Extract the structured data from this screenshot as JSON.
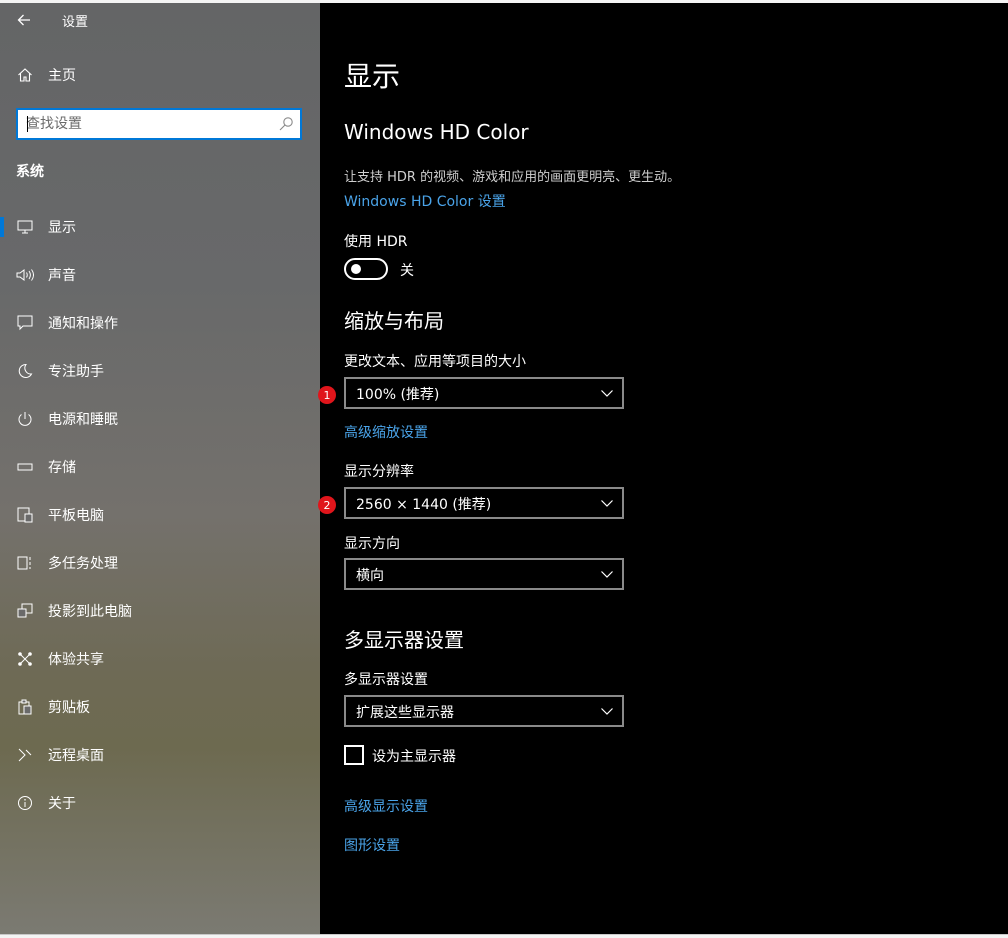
{
  "app": {
    "title": "设置"
  },
  "sidebar": {
    "home_label": "主页",
    "search_placeholder": "查找设置",
    "section": "系统",
    "items": [
      {
        "label": "显示",
        "icon": "monitor-icon",
        "active": true
      },
      {
        "label": "声音",
        "icon": "speaker-icon"
      },
      {
        "label": "通知和操作",
        "icon": "notification-icon"
      },
      {
        "label": "专注助手",
        "icon": "moon-icon"
      },
      {
        "label": "电源和睡眠",
        "icon": "power-icon"
      },
      {
        "label": "存储",
        "icon": "storage-icon"
      },
      {
        "label": "平板电脑",
        "icon": "tablet-icon"
      },
      {
        "label": "多任务处理",
        "icon": "multitask-icon"
      },
      {
        "label": "投影到此电脑",
        "icon": "project-icon"
      },
      {
        "label": "体验共享",
        "icon": "share-icon"
      },
      {
        "label": "剪贴板",
        "icon": "clipboard-icon"
      },
      {
        "label": "远程桌面",
        "icon": "remote-desktop-icon"
      },
      {
        "label": "关于",
        "icon": "info-icon"
      }
    ]
  },
  "main": {
    "page_title": "显示",
    "hdr": {
      "heading": "Windows HD Color",
      "description": "让支持 HDR 的视频、游戏和应用的画面更明亮、更生动。",
      "settings_link": "Windows HD Color 设置",
      "toggle_label": "使用 HDR",
      "toggle_state": "关",
      "toggle_on": false
    },
    "scale": {
      "heading": "缩放与布局",
      "size_label": "更改文本、应用等项目的大小",
      "size_value": "100% (推荐)",
      "size_badge": "1",
      "advanced_link": "高级缩放设置",
      "resolution_label": "显示分辨率",
      "resolution_value": "2560 × 1440 (推荐)",
      "resolution_badge": "2",
      "orientation_label": "显示方向",
      "orientation_value": "横向"
    },
    "multi": {
      "heading": "多显示器设置",
      "label": "多显示器设置",
      "value": "扩展这些显示器",
      "checkbox_label": "设为主显示器",
      "checkbox_checked": false
    },
    "links": {
      "advanced_display": "高级显示设置",
      "graphics": "图形设置"
    }
  },
  "colors": {
    "accent": "#0078d7",
    "link": "#4aa3e8",
    "badge": "#e0151b"
  }
}
